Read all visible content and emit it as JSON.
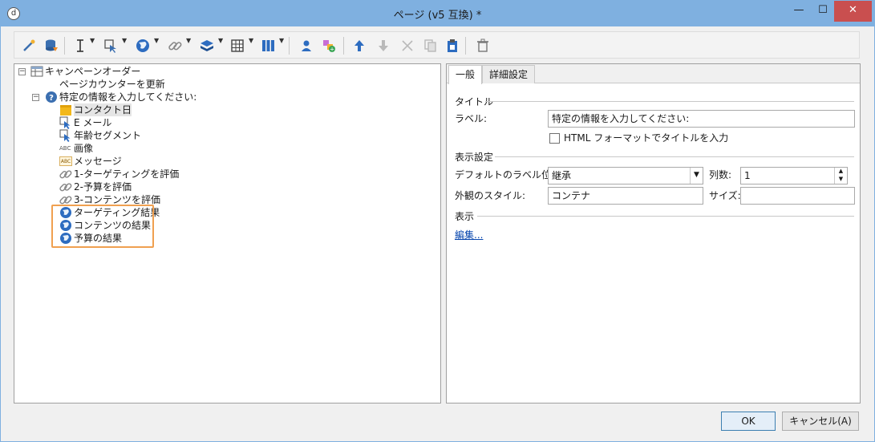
{
  "window": {
    "title": "ページ (v5 互換) *",
    "app_icon": "d",
    "controls": {
      "minimize": "—",
      "maximize": "☐",
      "close": "✕"
    }
  },
  "toolbar": {
    "icons": [
      "magic-wand-icon",
      "database-icon",
      "text-cursor-icon",
      "insert-field-icon",
      "globe-icon",
      "link-icon",
      "layers-icon",
      "grid-icon",
      "columns-icon",
      "user-icon",
      "add-shape-icon",
      "move-up-icon",
      "move-down-icon",
      "cut-icon",
      "copy-icon",
      "paste-icon",
      "delete-icon"
    ]
  },
  "tree": {
    "root": "キャンペーンオーダー",
    "items": [
      {
        "label": "ページカウンターを更新",
        "icon": "none"
      },
      {
        "label": "特定の情報を入力してください:",
        "icon": "question-icon"
      },
      {
        "label": "コンタクト日",
        "icon": "date-field-icon"
      },
      {
        "label": "E メール",
        "icon": "cursor-field-icon"
      },
      {
        "label": "年齢セグメント",
        "icon": "cursor-field-icon"
      },
      {
        "label": "画像",
        "icon": "abc-icon",
        "badge": "ABC"
      },
      {
        "label": "メッセージ",
        "icon": "message-icon",
        "badge": "ABC"
      },
      {
        "label": "1-ターゲティングを評価",
        "icon": "link-icon"
      },
      {
        "label": "2-予算を評価",
        "icon": "link-icon"
      },
      {
        "label": "3-コンテンツを評価",
        "icon": "link-icon"
      },
      {
        "label": "ターゲティング結果",
        "icon": "globe-icon"
      },
      {
        "label": "コンテンツの結果",
        "icon": "globe-icon"
      },
      {
        "label": "予算の結果",
        "icon": "globe-icon"
      }
    ]
  },
  "props": {
    "tabs": [
      "一般",
      "詳細設定"
    ],
    "title_section": "タイトル",
    "label_caption": "ラベル:",
    "label_value": "特定の情報を入力してください:",
    "html_checkbox": "HTML フォーマットでタイトルを入力",
    "display_section": "表示設定",
    "default_label_pos_caption": "デフォルトのラベル位置:",
    "default_label_pos_value": "継承",
    "columns_caption": "列数:",
    "columns_value": "1",
    "style_caption": "外観のスタイル:",
    "style_value": "コンテナ",
    "size_caption": "サイズ:",
    "size_value": "",
    "view_section": "表示",
    "edit_link": "編集..."
  },
  "buttons": {
    "ok": "OK",
    "cancel": "キャンセル(A)"
  },
  "colors": {
    "titlebar": "#7fb0e0",
    "close": "#c94f4f",
    "highlight": "#f0a050",
    "link": "#0645ad"
  }
}
